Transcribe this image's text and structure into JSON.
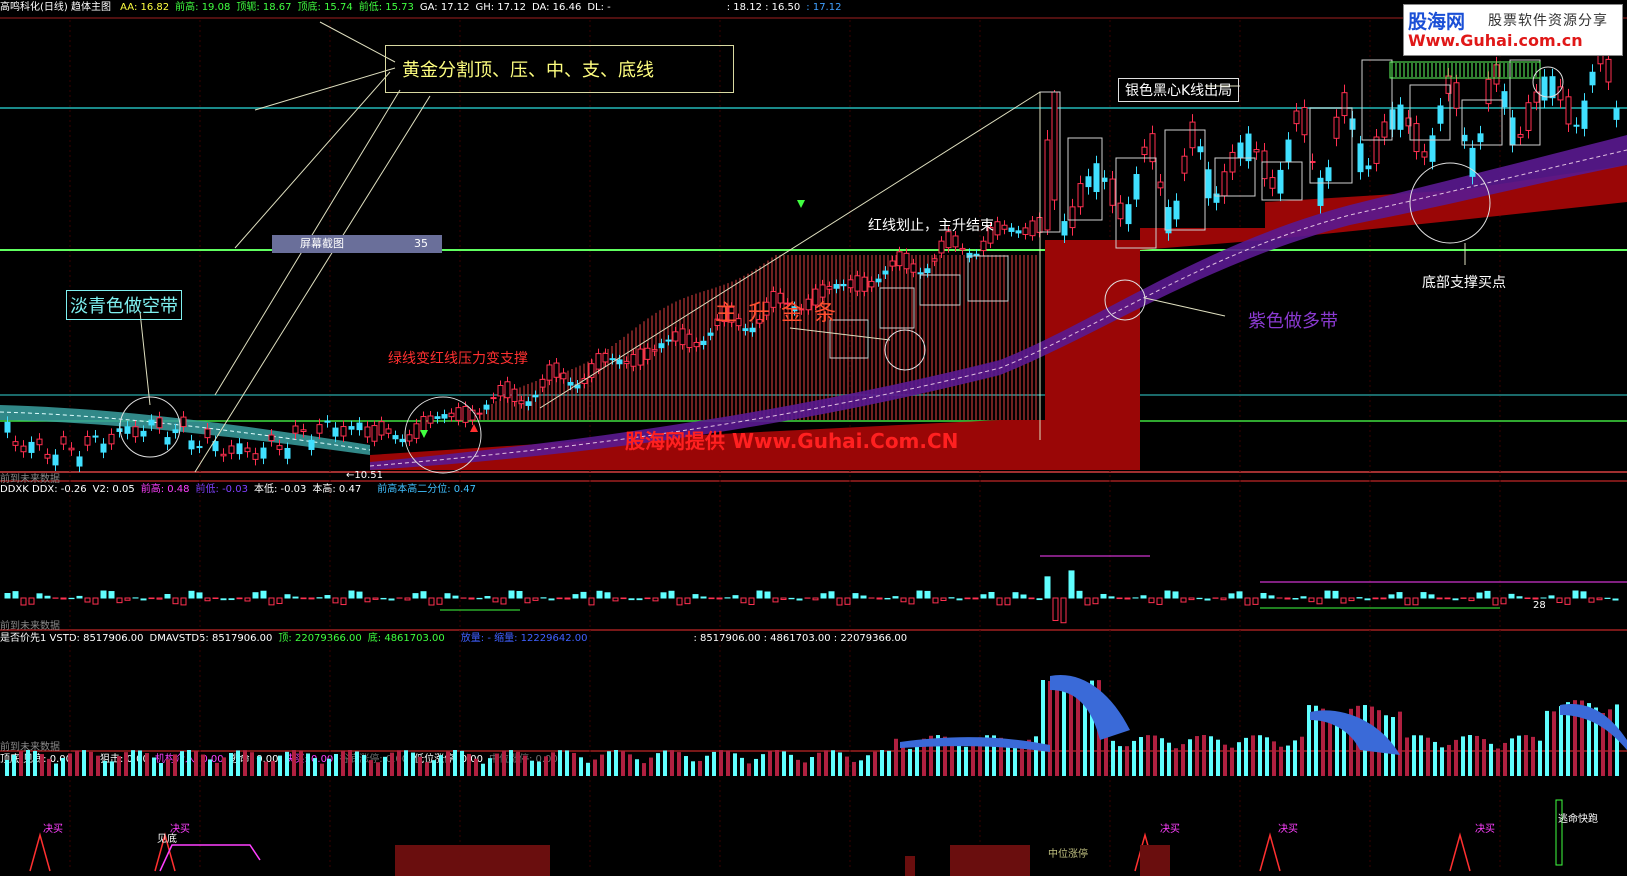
{
  "header_main": {
    "title": "高鸣科化(日线) 趋体主图",
    "items": [
      {
        "label": "AA: 16.82",
        "color": "#ffff40"
      },
      {
        "label": "前高: 19.08",
        "color": "#40ff40"
      },
      {
        "label": "顶轭: 18.67",
        "color": "#40ff40"
      },
      {
        "label": "顶底: 15.74",
        "color": "#40ff40"
      },
      {
        "label": "前低: 15.73",
        "color": "#40ff40"
      },
      {
        "label": "GA: 17.12",
        "color": "#ffffff"
      },
      {
        "label": "GH: 17.12",
        "color": "#ffffff"
      },
      {
        "label": "DA: 16.46",
        "color": "#ffffff"
      },
      {
        "label": "DL: -",
        "color": "#ffffff"
      },
      {
        "label": ": 18.12 : 16.50",
        "color": "#ffffff"
      },
      {
        "label": ": 17.12",
        "color": "#40a0ff"
      }
    ]
  },
  "header_ddx": {
    "items": [
      {
        "label": "DDXK DDX: -0.26",
        "color": "#ffffff"
      },
      {
        "label": "V2: 0.05",
        "color": "#ffffff"
      },
      {
        "label": "前高: 0.48",
        "color": "#ff40ff"
      },
      {
        "label": "前低: -0.03",
        "color": "#8040ff"
      },
      {
        "label": "本低: -0.03",
        "color": "#ffffff"
      },
      {
        "label": "本高: 0.47",
        "color": "#ffffff"
      },
      {
        "label": "前高本高二分位: 0.47",
        "color": "#40c0ff"
      }
    ]
  },
  "header_vstd": {
    "items": [
      {
        "label": "是否价先1 VSTD: 8517906.00",
        "color": "#ffffff"
      },
      {
        "label": "DMAVSTD5: 8517906.00",
        "color": "#ffffff"
      },
      {
        "label": "顶: 22079366.00",
        "color": "#40ff40"
      },
      {
        "label": "底: 4861703.00",
        "color": "#40ff40"
      },
      {
        "label": "放量: - 缩量: 12229642.00",
        "color": "#4060ff"
      },
      {
        "label": ": 8517906.00 : 4861703.00 : 22079366.00",
        "color": "#ffffff"
      }
    ]
  },
  "header_signal": {
    "items": [
      {
        "label": "顶底 见底: 0.00",
        "color": "#ffffff"
      },
      {
        "label": "狙击: 0.00",
        "color": "#ffffff"
      },
      {
        "label": "机构介入: 0.00",
        "color": "#ff40ff"
      },
      {
        "label": "逃命: 0.00",
        "color": "#ffffff"
      },
      {
        "label": "决买: 0.00",
        "color": "#ff40ff"
      },
      {
        "label": "谷底涨停: 0.00",
        "color": "#707070"
      },
      {
        "label": "低位涨停: 0.00",
        "color": "#ffffff"
      },
      {
        "label": "中位涨停: 0.00",
        "color": "#707070"
      }
    ]
  },
  "annotations": {
    "golden_box": "黄金分割顶、压、中、支、底线",
    "cyan_band": "淡青色做空带",
    "green_to_red": "绿线变红线压力变支撑",
    "main_rise": "主 升 金 条",
    "red_line_stop": "红线划止，主升结束",
    "silver_k": "银色黑心K线出局",
    "purple_band": "紫色做多带",
    "bottom_support": "底部支撑买点",
    "watermark": "股海网提供 Www.Guhai.Com.CN",
    "low_price": "←10.51",
    "no_data1": "前到未来数据",
    "no_data2": "前到未来数据",
    "no_data3": "前到未来数据",
    "ddx_marker": "28",
    "kuaimai": "决买",
    "taoming": "逃命快跑",
    "zhongwei": "中位涨停",
    "jiandi": "见底"
  },
  "screenshot_pill": {
    "label": "屏幕截图",
    "value": "35"
  },
  "logo": {
    "name": "股海网",
    "slogan": "股票软件资源分享",
    "url": "Www.Guhai.com.cn"
  }
}
